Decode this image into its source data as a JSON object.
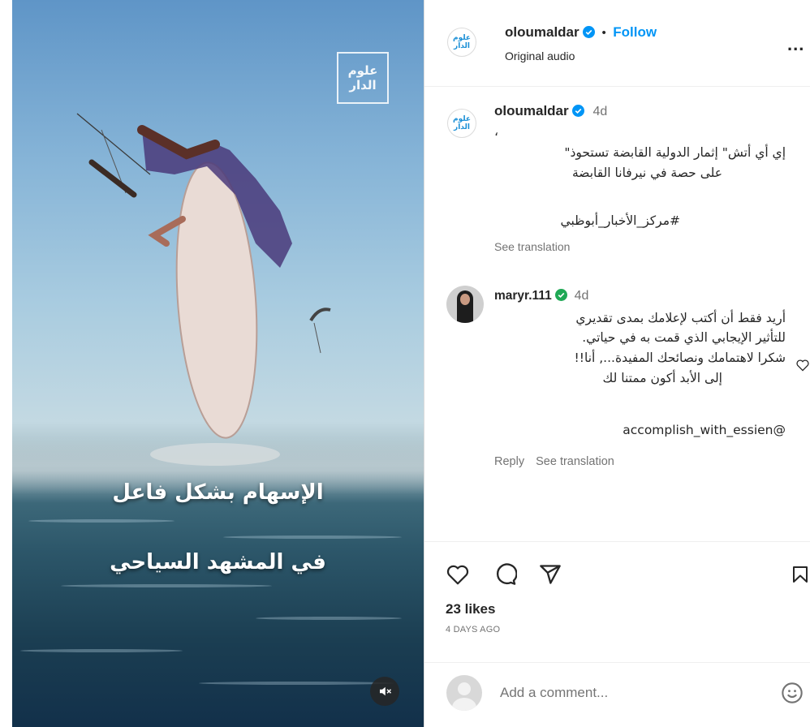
{
  "media": {
    "watermark": "علوم الدار",
    "overlay_line1": "الإسهام بشكل فاعل",
    "overlay_line2": "في المشهد السياحي"
  },
  "header": {
    "username": "oloumaldar",
    "separator": "•",
    "follow_label": "Follow",
    "audio_label": "Original audio",
    "more_label": "...",
    "avatar_text": "علوم الدار"
  },
  "caption": {
    "username": "oloumaldar",
    "time": "4d",
    "dot": "،",
    "line1": "إي أي أتش\" إثمار الدولية القابضة تستحوذ\"",
    "line2": "على حصة في نيرفانا القابضة",
    "hashtag": "#مركز_الأخبار_أبوظبي",
    "see_translation": "See translation"
  },
  "comment": {
    "username": "maryr.111",
    "time": "4d",
    "line1": "أريد فقط أن أكتب لإعلامك بمدى تقديري",
    "line2": "للتأثير الإيجابي الذي قمت به في حياتي.",
    "line3": "شكرا لاهتمامك ونصائحك المفيدة..., أنا!!",
    "line4": "إلى الأبد أكون ممتنا لك",
    "line5": "accomplish_with_essien@",
    "reply_label": "Reply",
    "see_translation": "See translation"
  },
  "actions": {
    "likes": "23 likes",
    "date": "4 DAYS AGO"
  },
  "add_comment": {
    "placeholder": "Add a comment..."
  },
  "colors": {
    "accent": "#0095f6",
    "verified": "#0095f6",
    "verified_comment": "#1fa855",
    "brand": "#1a8fd6",
    "muted": "#737373"
  }
}
